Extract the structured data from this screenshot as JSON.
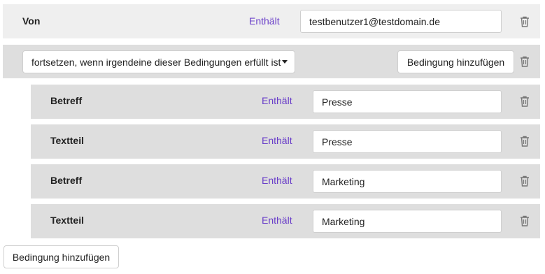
{
  "top_rule": {
    "field": "Von",
    "operator": "Enthält",
    "value": "testbenutzer1@testdomain.de"
  },
  "group": {
    "mode_select": "fortsetzen, wenn irgendeine dieser Bedingungen erfüllt ist",
    "add_button": "Bedingung hinzufügen",
    "rules": [
      {
        "field": "Betreff",
        "operator": "Enthält",
        "value": "Presse"
      },
      {
        "field": "Textteil",
        "operator": "Enthält",
        "value": "Presse"
      },
      {
        "field": "Betreff",
        "operator": "Enthält",
        "value": "Marketing"
      },
      {
        "field": "Textteil",
        "operator": "Enthält",
        "value": "Marketing"
      }
    ]
  },
  "footer": {
    "add_button": "Bedingung hinzufügen"
  },
  "icons": {
    "delete": "trash-icon",
    "dropdown": "caret-down-icon"
  },
  "colors": {
    "operator": "#6a3fc9",
    "row_light": "#efefef",
    "row_dark": "#dedede"
  }
}
